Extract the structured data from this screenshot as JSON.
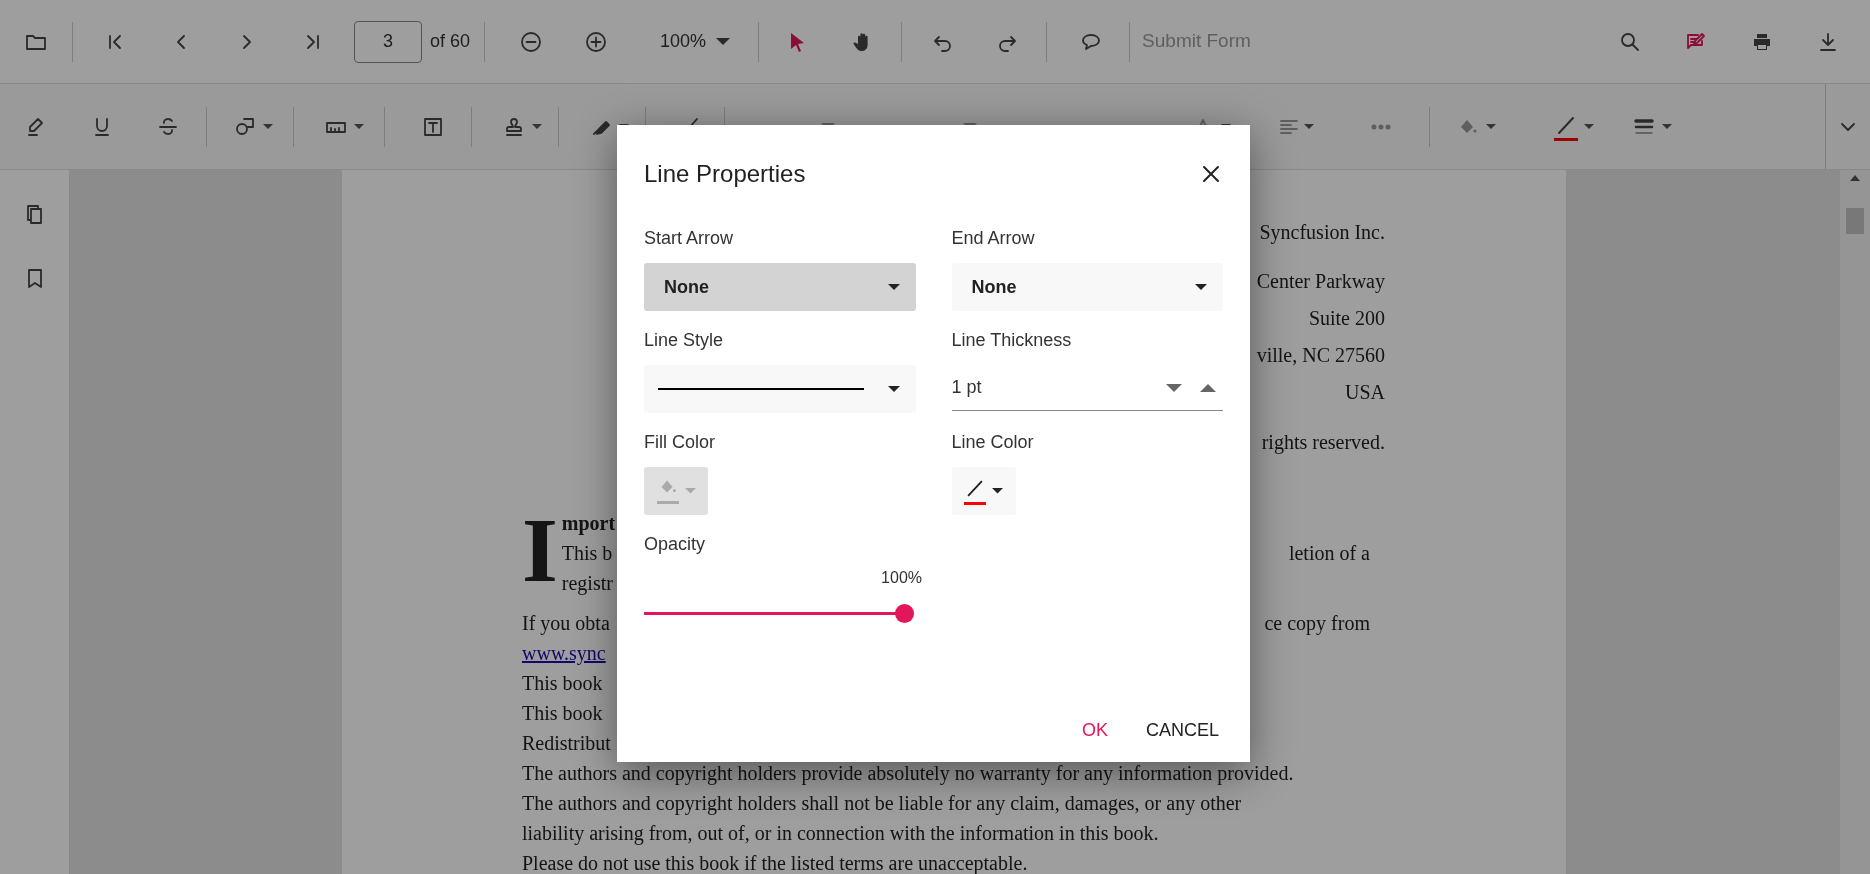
{
  "toolbar": {
    "page_number": "3",
    "page_count": "of 60",
    "zoom": "100%",
    "interaction_tools": [
      {
        "selected": true
      },
      {
        "selected": false
      }
    ],
    "submit_form": {
      "label": "Submit Form",
      "disabled": true
    },
    "right_tools": [
      {
        "selected": false
      },
      {
        "selected": true
      },
      {
        "selected": false
      },
      {
        "selected": false
      }
    ]
  },
  "document": {
    "address_lines": [
      "Syncfusion Inc.",
      "Center Parkway",
      "Suite 200",
      "ville, NC 27560",
      "USA",
      "rights reserved."
    ],
    "drop_cap": "I",
    "drop_cap_lines": [
      {
        "kind": "heading",
        "left": "mport"
      },
      {
        "kind": "text",
        "left": "This b",
        "right": "letion of a"
      },
      {
        "kind": "text",
        "left": "registr"
      }
    ],
    "lines": [
      {
        "kind": "text",
        "left": "If you obta",
        "right": "ce copy from"
      },
      {
        "kind": "link",
        "left": "www.sync"
      },
      {
        "kind": "text",
        "left": "This book"
      },
      {
        "kind": "text",
        "left": "This book"
      },
      {
        "kind": "text",
        "left": "Redistribut"
      },
      {
        "kind": "text",
        "left": "The authors and copyright holders provide absolutely no warranty for any information provided."
      },
      {
        "kind": "text",
        "left": "The authors and copyright holders shall not be liable for any claim, damages, or any other"
      },
      {
        "kind": "text",
        "left": "liability arising from, out of, or in connection with the information in this book."
      },
      {
        "kind": "text",
        "left": "Please do not use this book if the listed terms are unacceptable."
      }
    ]
  },
  "dialog": {
    "title": "Line Properties",
    "start_arrow": {
      "label": "Start Arrow",
      "value": "None",
      "focused": true
    },
    "end_arrow": {
      "label": "End Arrow",
      "value": "None",
      "focused": false
    },
    "line_style": {
      "label": "Line Style"
    },
    "line_thickness": {
      "label": "Line Thickness",
      "value": "1 pt"
    },
    "fill_color": {
      "label": "Fill Color",
      "disabled": true
    },
    "line_color": {
      "label": "Line Color",
      "color": "#ff0000"
    },
    "opacity": {
      "label": "Opacity",
      "reading": "100%",
      "level": 1
    },
    "buttons": [
      {
        "label": "OK",
        "primary": true
      },
      {
        "label": "CANCEL",
        "primary": false
      }
    ]
  }
}
